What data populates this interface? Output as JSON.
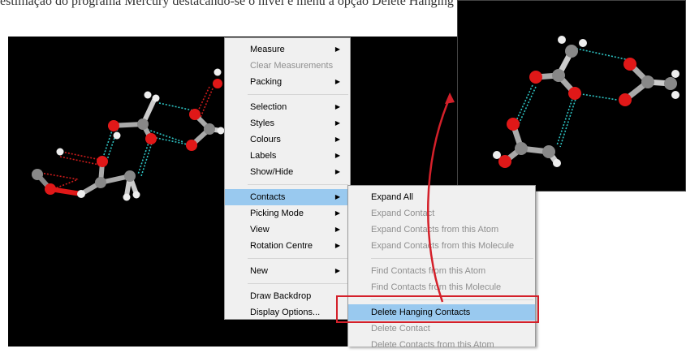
{
  "caption": "estimação do programa Mercury destacando-se o nível e menu a opção Delete Hanging Contacts",
  "colors": {
    "highlight": "#99c9ef",
    "callout": "#d4202a",
    "carbon": "#888888",
    "oxygen": "#e01818",
    "hydrogen": "#f2f2f2",
    "contact": "#2ec4c4",
    "hbond": "#cc1b1b"
  },
  "context_menu": {
    "items": [
      {
        "label": "Measure",
        "submenu": true
      },
      {
        "label": "Clear Measurements",
        "disabled": true
      },
      {
        "label": "Packing",
        "submenu": true
      },
      {
        "separator": true
      },
      {
        "label": "Selection",
        "submenu": true
      },
      {
        "label": "Styles",
        "submenu": true
      },
      {
        "label": "Colours",
        "submenu": true
      },
      {
        "label": "Labels",
        "submenu": true
      },
      {
        "label": "Show/Hide",
        "submenu": true
      },
      {
        "separator": true
      },
      {
        "label": "Contacts",
        "submenu": true,
        "highlighted": true
      },
      {
        "label": "Picking Mode",
        "submenu": true
      },
      {
        "label": "View",
        "submenu": true
      },
      {
        "label": "Rotation Centre",
        "submenu": true
      },
      {
        "separator": true
      },
      {
        "label": "New",
        "submenu": true
      },
      {
        "separator": true
      },
      {
        "label": "Draw Backdrop"
      },
      {
        "label": "Display Options..."
      }
    ]
  },
  "contacts_submenu": {
    "items": [
      {
        "label": "Expand All"
      },
      {
        "label": "Expand Contact",
        "disabled": true
      },
      {
        "label": "Expand Contacts from this Atom",
        "disabled": true
      },
      {
        "label": "Expand Contacts from this Molecule",
        "disabled": true
      },
      {
        "separator": true
      },
      {
        "label": "Find Contacts from this Atom",
        "disabled": true
      },
      {
        "label": "Find Contacts from this Molecule",
        "disabled": true
      },
      {
        "separator": true
      },
      {
        "label": "Delete Hanging Contacts",
        "highlighted": true
      },
      {
        "label": "Delete Contact",
        "disabled": true
      },
      {
        "label": "Delete Contacts from this Atom",
        "disabled": true
      }
    ]
  }
}
